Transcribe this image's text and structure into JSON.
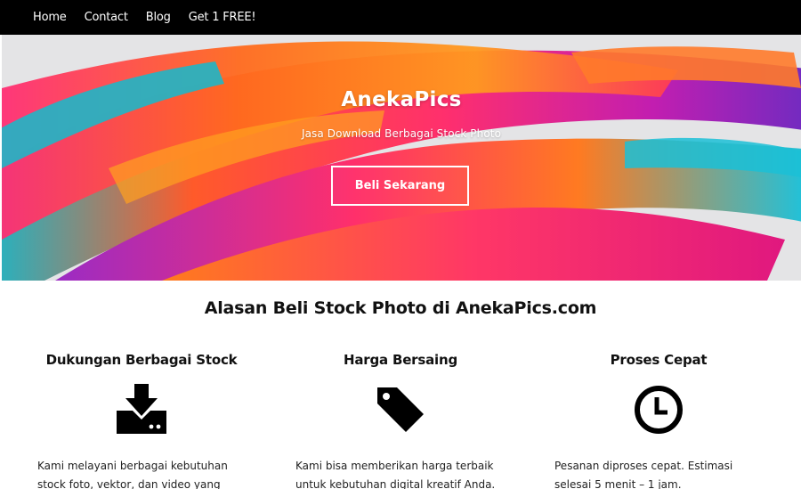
{
  "nav": {
    "items": [
      "Home",
      "Contact",
      "Blog",
      "Get 1 FREE!"
    ]
  },
  "hero": {
    "title": "AnekaPics",
    "subtitle": "Jasa Download Berbagai Stock Photo",
    "button_label": "Beli Sekarang"
  },
  "section": {
    "title": "Alasan Beli Stock Photo di AnekaPics.com"
  },
  "features": [
    {
      "title": "Dukungan Berbagai Stock",
      "icon": "download-icon",
      "text": "Kami melayani berbagai kebutuhan stock foto, vektor, dan video yang Anda"
    },
    {
      "title": "Harga Bersaing",
      "icon": "price-tag-icon",
      "text": "Kami bisa memberikan harga terbaik untuk kebutuhan digital kreatif Anda."
    },
    {
      "title": "Proses Cepat",
      "icon": "clock-icon",
      "text": "Pesanan diproses cepat. Estimasi selesai 5 menit – 1 jam."
    }
  ],
  "colors": {
    "nav_background": "#000000",
    "hero_background": "#e4e4e6",
    "text": "#111111"
  }
}
